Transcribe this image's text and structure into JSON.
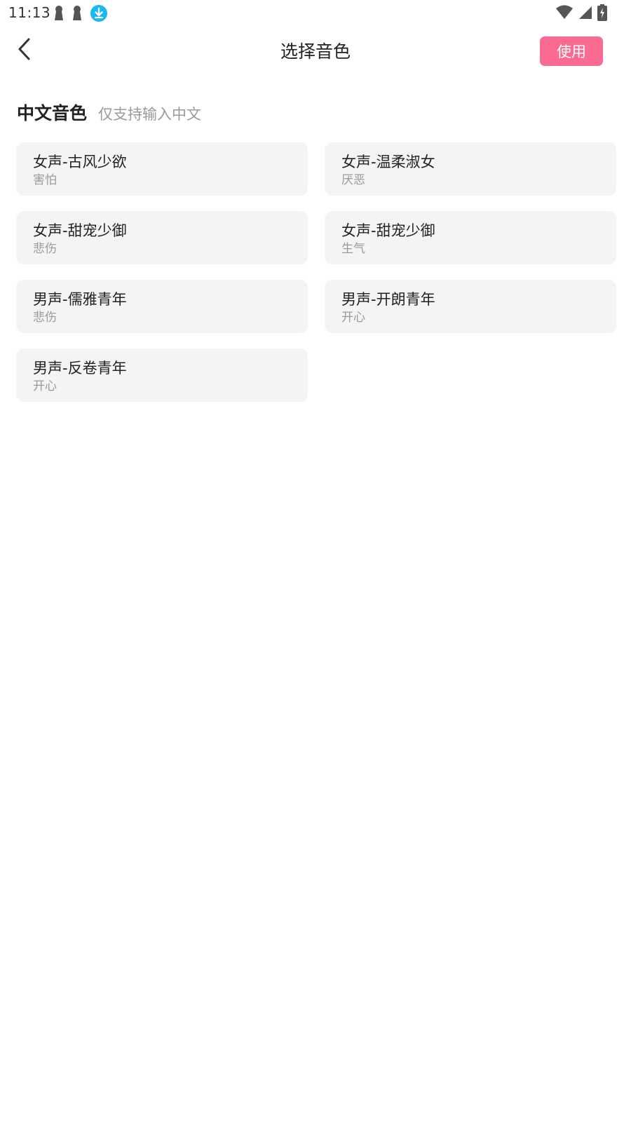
{
  "status_bar": {
    "time": "11:13",
    "left_icons": [
      "keyhole-icon",
      "keyhole-icon",
      "download-icon"
    ],
    "right_icons": [
      "wifi-icon",
      "signal-icon",
      "battery-charging-icon"
    ],
    "download_color": "#1ab8f0"
  },
  "header": {
    "title": "选择音色",
    "use_button_label": "使用",
    "accent_color": "#fb6a90"
  },
  "section": {
    "title": "中文音色",
    "hint": "仅支持输入中文"
  },
  "voices": [
    {
      "name": "女声-古风少欲",
      "emotion": "害怕"
    },
    {
      "name": "女声-温柔淑女",
      "emotion": "厌恶"
    },
    {
      "name": "女声-甜宠少御",
      "emotion": "悲伤"
    },
    {
      "name": "女声-甜宠少御",
      "emotion": "生气"
    },
    {
      "name": "男声-儒雅青年",
      "emotion": "悲伤"
    },
    {
      "name": "男声-开朗青年",
      "emotion": "开心"
    },
    {
      "name": "男声-反卷青年",
      "emotion": "开心"
    }
  ]
}
